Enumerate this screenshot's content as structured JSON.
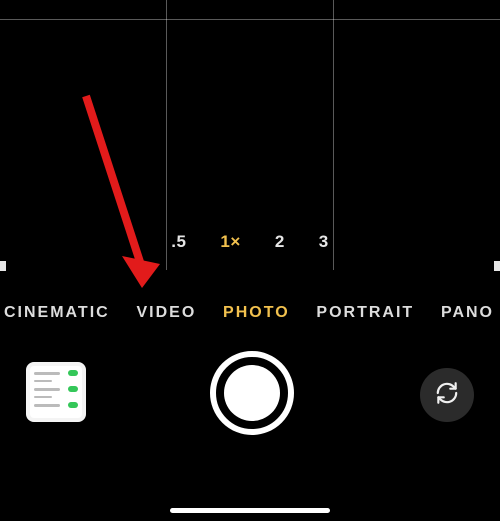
{
  "zoom": {
    "options": [
      ".5",
      "1×",
      "2",
      "3"
    ],
    "selected_index": 1
  },
  "modes": {
    "items": [
      "CINEMATIC",
      "VIDEO",
      "PHOTO",
      "PORTRAIT",
      "PANO"
    ],
    "selected_index": 2
  },
  "controls": {
    "thumbnail_label": "last-photo-thumbnail",
    "shutter_label": "shutter-button",
    "flip_label": "flip-camera-button"
  },
  "annotation": {
    "arrow_target": "video-mode"
  }
}
